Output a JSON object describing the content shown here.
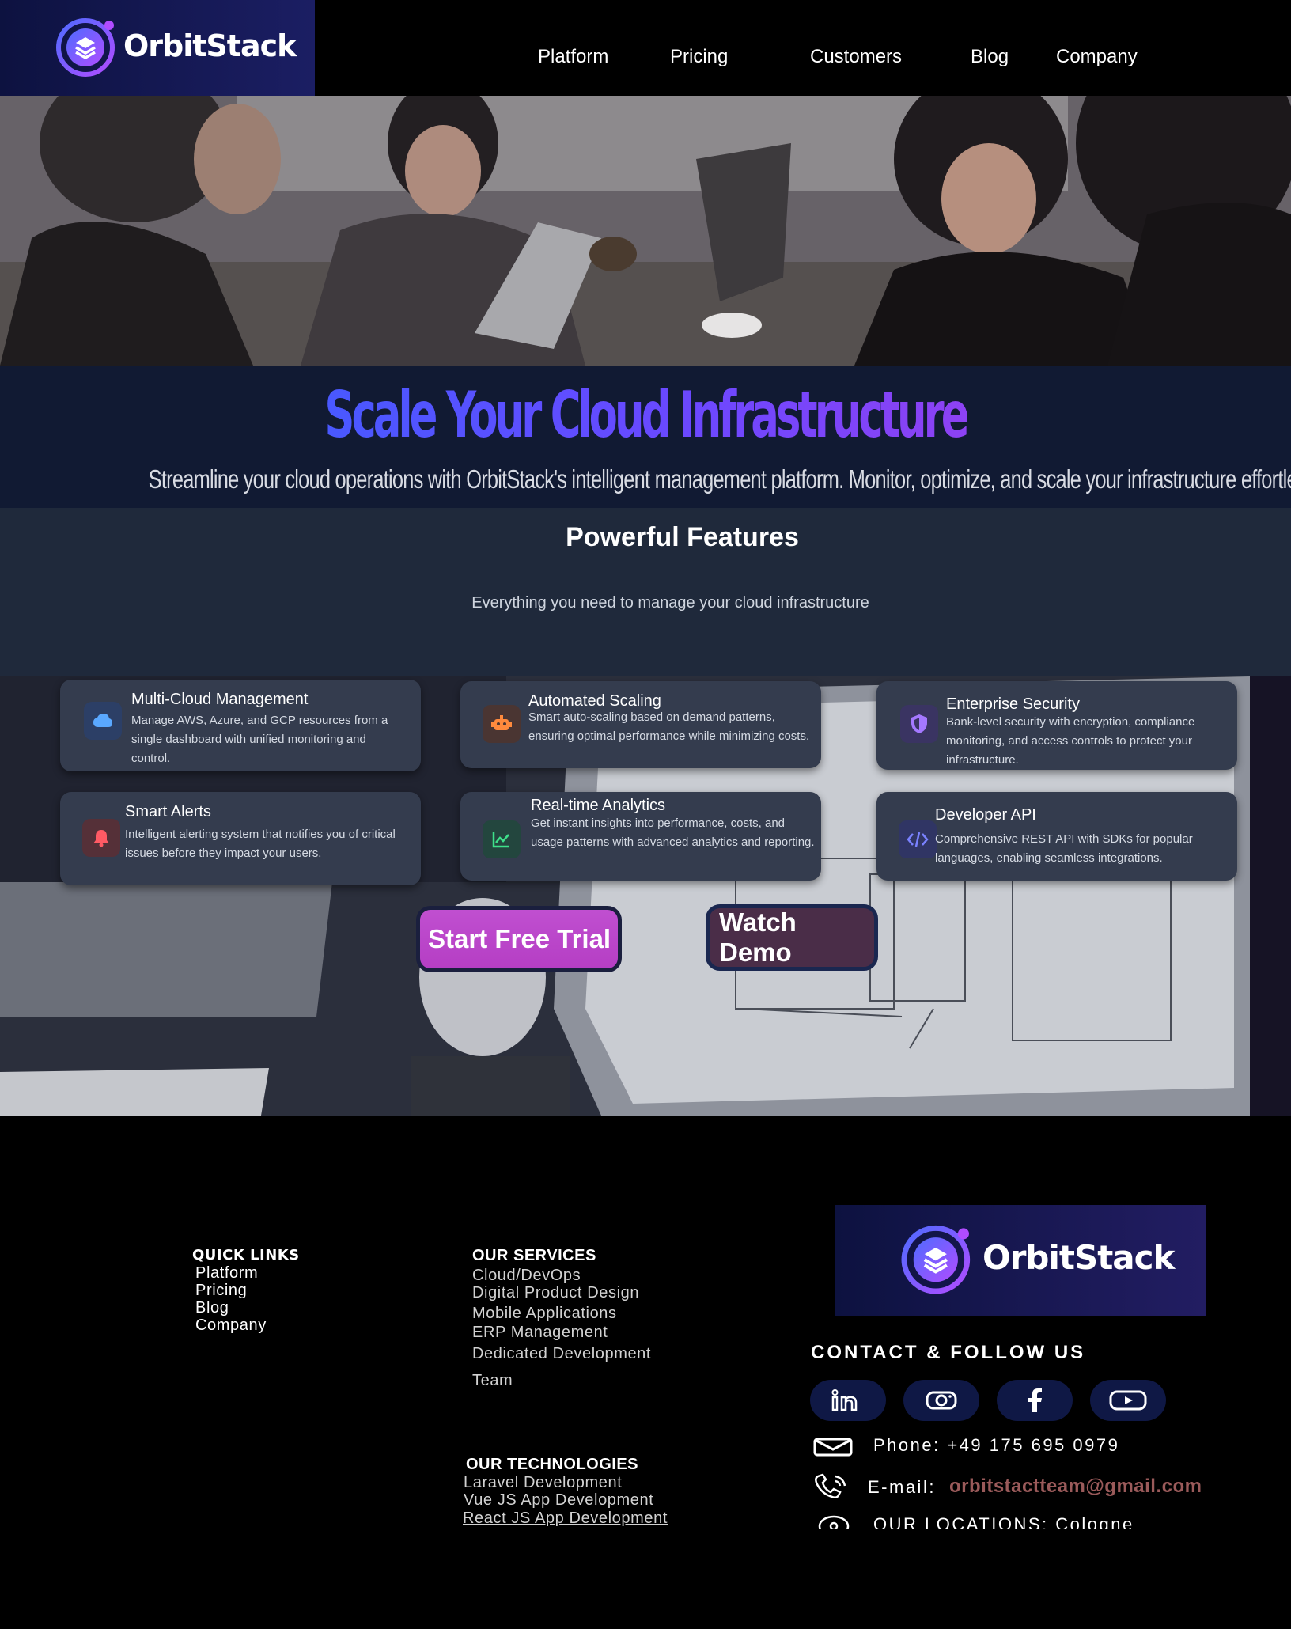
{
  "brand": {
    "name": "OrbitStack",
    "accent": "#7b5cff",
    "brand_dark": "#0d1240"
  },
  "nav": {
    "items": [
      {
        "label": "Platform"
      },
      {
        "label": "Pricing"
      },
      {
        "label": "Customers"
      },
      {
        "label": "Blog"
      },
      {
        "label": "Company"
      }
    ]
  },
  "hero": {
    "photo_description_icon": "team-meeting-photo",
    "headline": "Scale Your Cloud Infrastructure",
    "subhead": "Streamline your cloud operations with OrbitStack's intelligent management platform. Monitor, optimize, and scale your infrastructure effortlessly."
  },
  "features": {
    "title": "Powerful Features",
    "subtitle": "Everything you need to manage your cloud infrastructure",
    "cards": [
      {
        "icon": "cloud-icon",
        "title": "Multi-Cloud Management",
        "desc": "Manage AWS, Azure, and GCP resources from a single dashboard with unified monitoring and control."
      },
      {
        "icon": "robot-icon",
        "title": "Automated Scaling",
        "desc": "Smart auto-scaling based on demand patterns, ensuring optimal performance while minimizing costs."
      },
      {
        "icon": "shield-icon",
        "title": "Enterprise Security",
        "desc": "Bank-level security with encryption, compliance monitoring, and access controls to protect your infrastructure."
      },
      {
        "icon": "bell-icon",
        "title": "Smart Alerts",
        "desc": "Intelligent alerting system that notifies you of critical issues before they impact your users."
      },
      {
        "icon": "chart-line-icon",
        "title": "Real-time Analytics",
        "desc": "Get instant insights into performance, costs, and usage patterns with advanced analytics and reporting."
      },
      {
        "icon": "code-icon",
        "title": "Developer API",
        "desc": "Comprehensive REST API with SDKs for popular languages, enabling seamless integrations."
      }
    ]
  },
  "cta": {
    "primary": "Start Free Trial",
    "secondary": "Watch Demo"
  },
  "footer": {
    "quick_links": {
      "heading": "QUICK LINKS",
      "items": [
        "Platform",
        "Pricing",
        "Blog",
        "Company"
      ]
    },
    "services": {
      "heading": "OUR SERVICES",
      "items": [
        "Cloud/DevOps",
        "Digital Product Design",
        "Mobile Applications",
        "ERP Management",
        "Dedicated Development",
        "Team"
      ]
    },
    "technologies": {
      "heading": "OUR TECHNOLOGIES",
      "items": [
        "Laravel Development",
        "Vue JS App Development",
        "React JS App Development"
      ]
    },
    "contact": {
      "heading": "CONTACT & FOLLOW US",
      "social": [
        "linkedin-icon",
        "instagram-icon",
        "facebook-icon",
        "youtube-icon"
      ],
      "phone": "Phone: +49 175 695 0979",
      "email_label": "E-mail:",
      "email": "orbitstactteam@gmail.com",
      "locations": "OUR LOCATIONS: Cologne"
    }
  }
}
